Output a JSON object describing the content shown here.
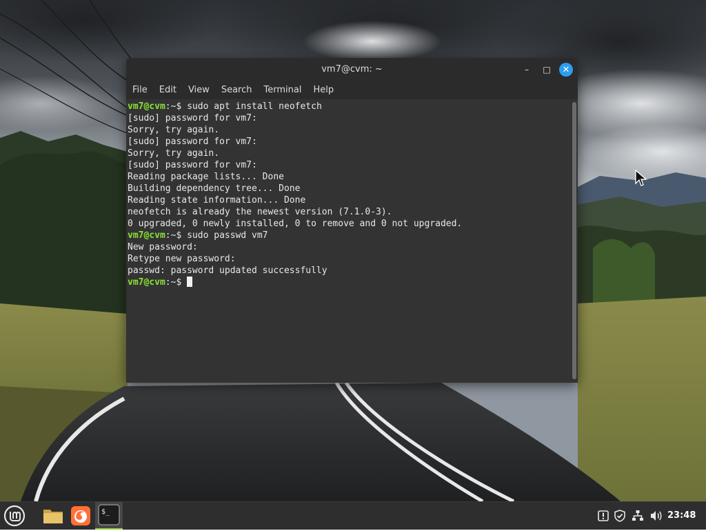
{
  "window": {
    "title": "vm7@cvm: ~",
    "controls": {
      "minimize": "–",
      "maximize": "□",
      "close": "✕"
    }
  },
  "menubar": [
    "File",
    "Edit",
    "View",
    "Search",
    "Terminal",
    "Help"
  ],
  "terminal": {
    "lines": [
      {
        "prompt": "vm7@cvm",
        "sep": ":~$ ",
        "text": "sudo apt install neofetch"
      },
      {
        "text": "[sudo] password for vm7:"
      },
      {
        "text": "Sorry, try again."
      },
      {
        "text": "[sudo] password for vm7:"
      },
      {
        "text": "Sorry, try again."
      },
      {
        "text": "[sudo] password for vm7:"
      },
      {
        "text": "Reading package lists... Done"
      },
      {
        "text": "Building dependency tree... Done"
      },
      {
        "text": "Reading state information... Done"
      },
      {
        "text": "neofetch is already the newest version (7.1.0-3)."
      },
      {
        "text": "0 upgraded, 0 newly installed, 0 to remove and 0 not upgraded."
      },
      {
        "prompt": "vm7@cvm",
        "sep": ":~$ ",
        "text": "sudo passwd vm7"
      },
      {
        "text": "New password:"
      },
      {
        "text": "Retype new password:"
      },
      {
        "text": "passwd: password updated successfully"
      },
      {
        "prompt": "vm7@cvm",
        "sep": ":~$ ",
        "text": "",
        "cursor": true
      }
    ],
    "colors": {
      "prompt": "#8ae234",
      "text": "#e8e8e8",
      "background": "#333333"
    }
  },
  "taskbar": {
    "launchers": [
      {
        "name": "menu",
        "icon": "linux-mint-logo-icon"
      },
      {
        "name": "files",
        "icon": "folder-icon"
      },
      {
        "name": "firefox",
        "icon": "firefox-icon"
      },
      {
        "name": "terminal",
        "icon": "terminal-icon",
        "label": "$_"
      }
    ],
    "tray": [
      "update-manager-icon",
      "shield-icon",
      "network-icon",
      "volume-icon"
    ],
    "clock": "23:48"
  }
}
